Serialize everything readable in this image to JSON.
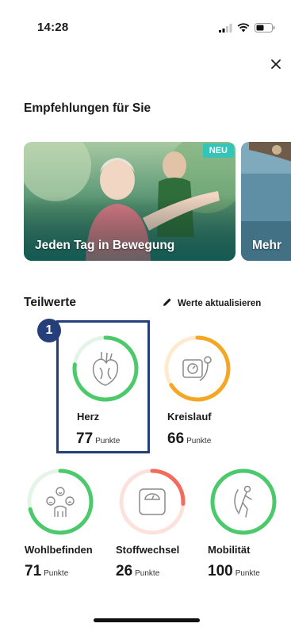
{
  "status_bar": {
    "time": "14:28"
  },
  "header": {
    "close_icon": "close-icon"
  },
  "recommendations": {
    "title": "Empfehlungen für Sie",
    "cards": [
      {
        "label": "Jeden Tag in Bewegung",
        "badge": "NEU"
      },
      {
        "label": "Mehr"
      }
    ]
  },
  "partial_values": {
    "title": "Teilwerte",
    "update_label": "Werte aktualisieren",
    "step_badge": "1",
    "metrics": [
      {
        "name": "Herz",
        "value": "77",
        "unit": "Punkte",
        "score_fraction": 0.77,
        "color": "#4cc96b",
        "icon": "heart-icon"
      },
      {
        "name": "Kreislauf",
        "value": "66",
        "unit": "Punkte",
        "score_fraction": 0.66,
        "color": "#f5a623",
        "icon": "blood-pressure-icon"
      },
      {
        "name": "Wohlbefinden",
        "value": "71",
        "unit": "Punkte",
        "score_fraction": 0.71,
        "color": "#4cc96b",
        "icon": "people-mood-icon"
      },
      {
        "name": "Stoffwechsel",
        "value": "26",
        "unit": "Punkte",
        "score_fraction": 0.26,
        "color": "#f26b5b",
        "icon": "scale-icon"
      },
      {
        "name": "Mobilität",
        "value": "100",
        "unit": "Punkte",
        "score_fraction": 1.0,
        "color": "#4cc96b",
        "icon": "mobility-icon"
      }
    ]
  }
}
